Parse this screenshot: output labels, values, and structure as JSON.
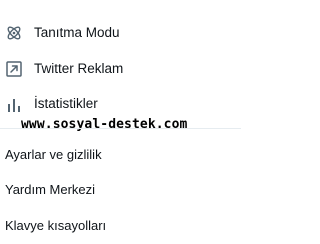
{
  "menu": {
    "items": [
      {
        "label": "Tanıtma Modu",
        "icon": "atom-icon"
      },
      {
        "label": "Twitter Reklam",
        "icon": "external-arrow-icon"
      },
      {
        "label": "İstatistikler",
        "icon": "bar-chart-icon"
      }
    ],
    "secondary": [
      {
        "label": "Ayarlar ve gizlilik"
      },
      {
        "label": "Yardım Merkezi"
      },
      {
        "label": "Klavye kısayolları"
      }
    ]
  },
  "watermark": "www.sosyal-destek.com",
  "colors": {
    "text": "#0f1419",
    "icon": "#536471",
    "divider": "#e6ecf0",
    "watermark": "#000000"
  }
}
